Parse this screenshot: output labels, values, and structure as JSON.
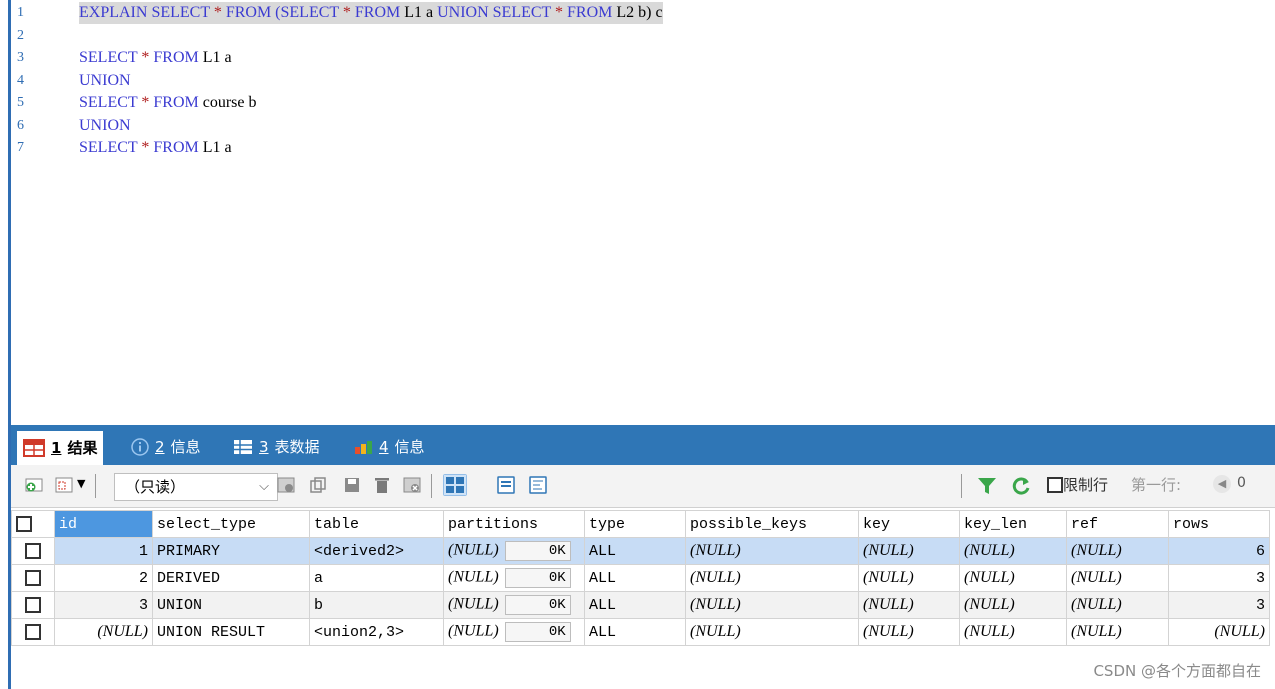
{
  "editor": {
    "lines": [
      {
        "n": "1",
        "parts": [
          [
            "kw",
            "EXPLAIN SELECT "
          ],
          [
            "op",
            "* "
          ],
          [
            "kw",
            "FROM "
          ],
          [
            "kw",
            "(SELECT "
          ],
          [
            "op",
            "* "
          ],
          [
            "kw",
            "FROM "
          ],
          [
            "t",
            "L1 a "
          ],
          [
            "kw",
            "UNION SELECT "
          ],
          [
            "op",
            "* "
          ],
          [
            "kw",
            "FROM "
          ],
          [
            "t",
            "L2 b) c"
          ]
        ],
        "highlight": true
      },
      {
        "n": "2",
        "parts": []
      },
      {
        "n": "3",
        "parts": [
          [
            "kw",
            "SELECT "
          ],
          [
            "op",
            "* "
          ],
          [
            "kw",
            "FROM "
          ],
          [
            "t",
            "L1 a"
          ]
        ]
      },
      {
        "n": "4",
        "parts": [
          [
            "kw",
            "UNION"
          ]
        ]
      },
      {
        "n": "5",
        "parts": [
          [
            "kw",
            "SELECT "
          ],
          [
            "op",
            "* "
          ],
          [
            "kw",
            "FROM "
          ],
          [
            "t",
            "course b"
          ]
        ]
      },
      {
        "n": "6",
        "parts": [
          [
            "kw",
            "UNION"
          ]
        ]
      },
      {
        "n": "7",
        "parts": [
          [
            "kw",
            "SELECT "
          ],
          [
            "op",
            "* "
          ],
          [
            "kw",
            "FROM "
          ],
          [
            "t",
            "L1 a"
          ]
        ]
      }
    ]
  },
  "tabs": [
    {
      "num": "1",
      "label": "结果",
      "active": true
    },
    {
      "num": "2",
      "label": "信息"
    },
    {
      "num": "3",
      "label": "表数据"
    },
    {
      "num": "4",
      "label": "信息"
    }
  ],
  "toolbar": {
    "readonly_select": "（只读）",
    "limit_rows_label": "限制行",
    "first_row_label": "第一行:",
    "first_row_value": "0"
  },
  "grid": {
    "columns": [
      "id",
      "select_type",
      "table",
      "partitions",
      "type",
      "possible_keys",
      "key",
      "key_len",
      "ref",
      "rows"
    ],
    "rows": [
      {
        "id": "1",
        "select_type": "PRIMARY",
        "table": "<derived2>",
        "partitions": "(NULL)",
        "size": "0K",
        "type": "ALL",
        "possible_keys": "(NULL)",
        "key": "(NULL)",
        "key_len": "(NULL)",
        "ref": "(NULL)",
        "rows": "6"
      },
      {
        "id": "2",
        "select_type": "DERIVED",
        "table": "a",
        "partitions": "(NULL)",
        "size": "0K",
        "type": "ALL",
        "possible_keys": "(NULL)",
        "key": "(NULL)",
        "key_len": "(NULL)",
        "ref": "(NULL)",
        "rows": "3"
      },
      {
        "id": "3",
        "select_type": "UNION",
        "table": "b",
        "partitions": "(NULL)",
        "size": "0K",
        "type": "ALL",
        "possible_keys": "(NULL)",
        "key": "(NULL)",
        "key_len": "(NULL)",
        "ref": "(NULL)",
        "rows": "3"
      },
      {
        "id": "(NULL)",
        "select_type": "UNION RESULT",
        "table": "<union2,3>",
        "partitions": "(NULL)",
        "size": "0K",
        "type": "ALL",
        "possible_keys": "(NULL)",
        "key": "(NULL)",
        "key_len": "(NULL)",
        "ref": "(NULL)",
        "rows": "(NULL)"
      }
    ]
  },
  "watermark": "CSDN @各个方面都自在",
  "colors": {
    "accent": "#2f76b6",
    "selected_row": "#c7dcf5",
    "keyword": "#3b3bd1"
  }
}
